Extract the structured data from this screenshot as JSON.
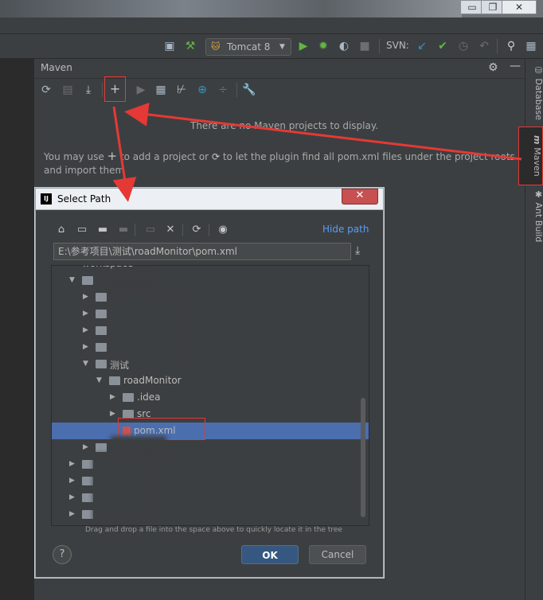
{
  "window": {
    "minimize": "▭",
    "restore": "❐",
    "close": "✕"
  },
  "toolbar": {
    "run_config": "Tomcat 8",
    "svn_label": "SVN:"
  },
  "maven": {
    "title": "Maven",
    "empty_message": "There are no Maven projects to display.",
    "hint_prefix": "You may use",
    "hint_middle": "to add a project or",
    "hint_suffix": "to let the plugin find all pom.xml files under the project roots",
    "hint_line2": "and import them",
    "plus_icon": "+",
    "refresh_icon": "⟳"
  },
  "right_tabs": [
    "Database",
    "Maven",
    "Ant Build"
  ],
  "dialog": {
    "title": "Select Path",
    "close_label": "✕",
    "hide_path": "Hide path",
    "path_value": "E:\\参考项目\\测试\\roadMonitor\\pom.xml",
    "tree": [
      {
        "label": "workspace",
        "indent": 0,
        "arrow": "▶",
        "folder": false
      },
      {
        "label": "",
        "indent": 0,
        "arrow": "▼",
        "folder": true
      },
      {
        "label": "",
        "indent": 1,
        "arrow": "▶",
        "folder": true
      },
      {
        "label": "",
        "indent": 1,
        "arrow": "▶",
        "folder": true
      },
      {
        "label": "",
        "indent": 1,
        "arrow": "▶",
        "folder": true
      },
      {
        "label": "",
        "indent": 1,
        "arrow": "▶",
        "folder": true
      },
      {
        "label": "测试",
        "indent": 1,
        "arrow": "▼",
        "folder": true
      },
      {
        "label": "roadMonitor",
        "indent": 2,
        "arrow": "▼",
        "folder": true
      },
      {
        "label": ".idea",
        "indent": 3,
        "arrow": "▶",
        "folder": true
      },
      {
        "label": "src",
        "indent": 3,
        "arrow": "▶",
        "folder": true
      },
      {
        "label": "pom.xml",
        "indent": 3,
        "arrow": "",
        "folder": false,
        "selected": true
      },
      {
        "label": "",
        "indent": 1,
        "arrow": "▶",
        "folder": true
      },
      {
        "label": "",
        "indent": 0,
        "arrow": "▶",
        "folder": true
      },
      {
        "label": "",
        "indent": 0,
        "arrow": "▶",
        "folder": true
      },
      {
        "label": "",
        "indent": 0,
        "arrow": "▶",
        "folder": true
      },
      {
        "label": "",
        "indent": 0,
        "arrow": "▶",
        "folder": true
      }
    ],
    "drag_hint": "Drag and drop a file into the space above to quickly locate it in the tree",
    "help_label": "?",
    "ok_label": "OK",
    "cancel_label": "Cancel"
  },
  "colors": {
    "accent_blue": "#589df6",
    "selection": "#4b6eaf",
    "annotation_red": "#e53935",
    "ok_button": "#365880"
  }
}
